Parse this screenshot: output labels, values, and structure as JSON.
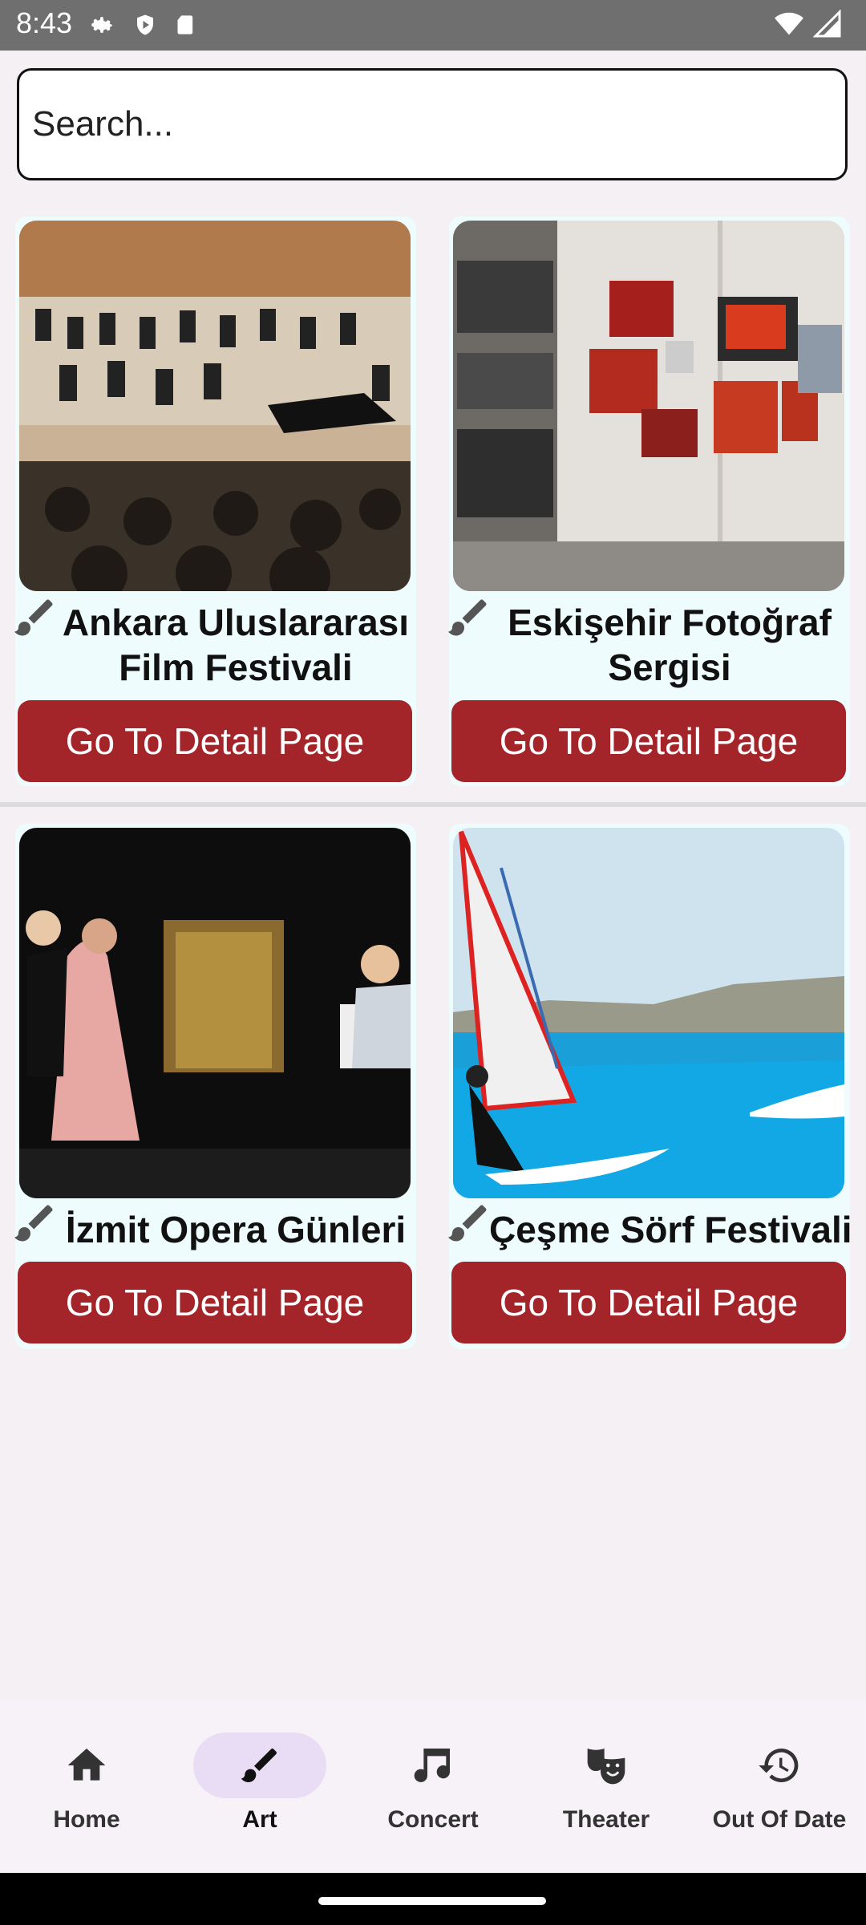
{
  "status_bar": {
    "time": "8:43"
  },
  "search": {
    "placeholder": "Search..."
  },
  "cards": [
    {
      "title_line1": "Ankara Uluslararası",
      "title_line2": "Film Festivali",
      "button_label": "Go To Detail Page",
      "image": "orchestra-concert-photo"
    },
    {
      "title_line1": "Eskişehir Fotoğraf",
      "title_line2": "Sergisi",
      "button_label": "Go To Detail Page",
      "image": "photo-exhibition-photo"
    },
    {
      "title_line1": "İzmit Opera Günleri",
      "button_label": "Go To Detail Page",
      "image": "opera-stage-photo"
    },
    {
      "title_line1": "Çeşme Sörf Festivali",
      "button_label": "Go To Detail Page",
      "image": "windsurf-photo"
    }
  ],
  "bottom_nav": {
    "active": "Art",
    "items": [
      {
        "label": "Home",
        "icon": "home-icon"
      },
      {
        "label": "Art",
        "icon": "brush-icon"
      },
      {
        "label": "Concert",
        "icon": "music-note-icon"
      },
      {
        "label": "Theater",
        "icon": "theater-masks-icon"
      },
      {
        "label": "Out Of Date",
        "icon": "history-icon"
      }
    ]
  },
  "colors": {
    "accent": "#a3252a",
    "card_bg": "#eefcfd",
    "nav_active": "#e9ddf5"
  }
}
